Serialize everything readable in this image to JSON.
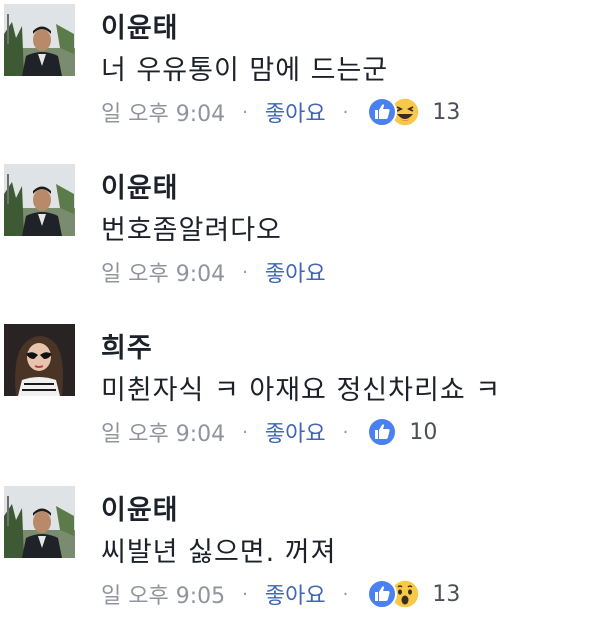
{
  "comments": [
    {
      "author": "이윤태",
      "text": "너 우유통이 맘에 드는군",
      "time": "일 오후 9:04",
      "like_label": "좋아요",
      "reactions": [
        "like-icon",
        "laugh-icon"
      ],
      "reaction_count": "13"
    },
    {
      "author": "이윤태",
      "text": "번호좀알려다오",
      "time": "일 오후 9:04",
      "like_label": "좋아요"
    },
    {
      "author": "희주",
      "text": "미췬자식 ㅋ 아재요 정신차리쇼 ㅋ",
      "time": "일 오후 9:04",
      "like_label": "좋아요",
      "reactions": [
        "like-icon"
      ],
      "reaction_count": "10"
    },
    {
      "author": "이윤태",
      "text": "씨발년 싫으면. 꺼져",
      "time": "일 오후 9:05",
      "like_label": "좋아요",
      "reactions": [
        "like-icon",
        "wow-icon"
      ],
      "reaction_count": "13"
    }
  ],
  "meta_separator": "·",
  "colors": {
    "author_text": "#1d2129",
    "meta_text": "#90949c",
    "like_link": "#4267b2",
    "like_reaction": "#4a80f0",
    "emoji_yellow": "#f7c948"
  }
}
